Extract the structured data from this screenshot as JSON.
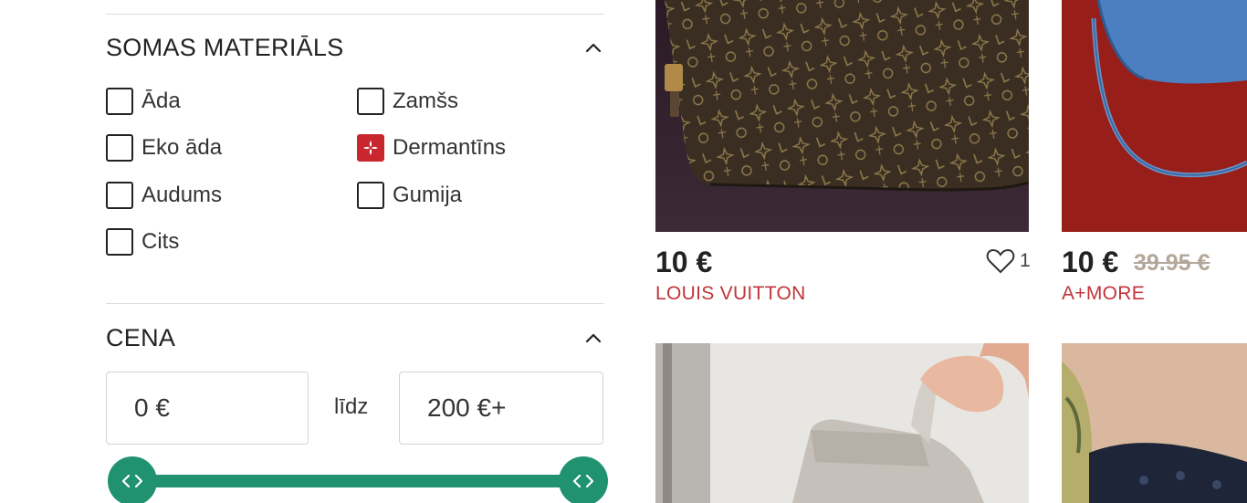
{
  "filters": {
    "material": {
      "title": "SOMAS MATERIĀLS",
      "options": [
        {
          "label": "Āda",
          "checked": false
        },
        {
          "label": "Zamšs",
          "checked": false
        },
        {
          "label": "Eko āda",
          "checked": false
        },
        {
          "label": "Dermantīns",
          "checked": true
        },
        {
          "label": "Audums",
          "checked": false
        },
        {
          "label": "Gumija",
          "checked": false
        },
        {
          "label": "Cits",
          "checked": false
        }
      ]
    },
    "price": {
      "title": "CENA",
      "min_value": "0 €",
      "max_value": "200 €+",
      "separator": "līdz",
      "slider_min": 0,
      "slider_max": 200
    }
  },
  "products": [
    {
      "price": "10 €",
      "old_price": "",
      "brand": "LOUIS VUITTON",
      "likes": "1"
    },
    {
      "price": "10 €",
      "old_price": "39.95 €",
      "brand": "A+MORE",
      "likes": ""
    }
  ],
  "colors": {
    "accent_green": "#209270",
    "brand_red": "#c0343a",
    "checked_red": "#c8272d"
  },
  "icons": {
    "collapse": "chevron-up-icon",
    "checked_mark": "flower-mark-icon",
    "slider_handle": "left-right-arrows-icon",
    "favorite": "heart-outline-icon"
  }
}
